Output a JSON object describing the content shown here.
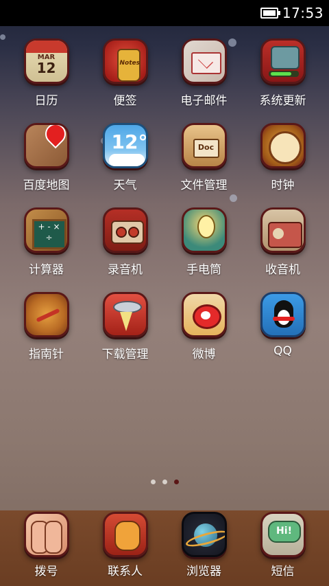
{
  "status_bar": {
    "time": "17:53",
    "battery_icon": "battery-full-icon"
  },
  "home_grid": [
    {
      "label": "日历",
      "icon": "calendar-icon",
      "icon_text_month": "MAR",
      "icon_text_day": "12"
    },
    {
      "label": "便签",
      "icon": "notes-icon",
      "icon_text": "Notes"
    },
    {
      "label": "电子邮件",
      "icon": "email-icon"
    },
    {
      "label": "系统更新",
      "icon": "system-update-icon"
    },
    {
      "label": "百度地图",
      "icon": "map-icon"
    },
    {
      "label": "天气",
      "icon": "weather-icon",
      "icon_text": "12°"
    },
    {
      "label": "文件管理",
      "icon": "file-manager-icon",
      "icon_text": "Doc"
    },
    {
      "label": "时钟",
      "icon": "clock-icon"
    },
    {
      "label": "计算器",
      "icon": "calculator-icon",
      "icon_text": "+ - × ÷"
    },
    {
      "label": "录音机",
      "icon": "recorder-icon"
    },
    {
      "label": "手电筒",
      "icon": "flashlight-icon"
    },
    {
      "label": "收音机",
      "icon": "radio-icon"
    },
    {
      "label": "指南针",
      "icon": "compass-icon"
    },
    {
      "label": "下载管理",
      "icon": "download-manager-icon"
    },
    {
      "label": "微博",
      "icon": "weibo-icon"
    },
    {
      "label": "QQ",
      "icon": "qq-icon"
    }
  ],
  "page_indicator": {
    "pages": 3,
    "current": 3
  },
  "dock": [
    {
      "label": "拨号",
      "icon": "dialer-icon"
    },
    {
      "label": "联系人",
      "icon": "contacts-icon"
    },
    {
      "label": "浏览器",
      "icon": "browser-icon"
    },
    {
      "label": "短信",
      "icon": "sms-icon",
      "icon_text": "Hi!"
    }
  ]
}
